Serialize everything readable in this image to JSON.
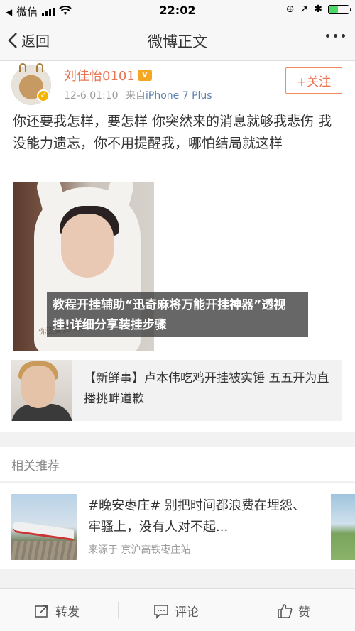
{
  "status_bar": {
    "carrier": "微信",
    "network": "4G",
    "time": "22:02"
  },
  "nav": {
    "back_label": "返回",
    "title": "微博正文"
  },
  "post": {
    "username": "刘佳怡0101",
    "time": "12-6 01:10",
    "source_prefix": "来自",
    "device": "iPhone 7 Plus",
    "follow_label": "+关注",
    "text": "你还要我怎样，要怎样 你突然来的消息就够我悲伤 我没能力遗忘，你不用提醒我，哪怕结局就这样",
    "image_watermark": "你还要我怎样"
  },
  "overlay": {
    "text": "教程开挂辅助“迅奇麻将万能开挂神器”透视挂!详细分享装挂步骤"
  },
  "news_card": {
    "text": "【新鲜事】卢本伟吃鸡开挂被实锤 五五开为直播挑衅道歉"
  },
  "related": {
    "header": "相关推荐",
    "title": "#晚安枣庄# 别把时间都浪费在埋怨、牢骚上，没有人对不起...",
    "source": "来源于 京沪高铁枣庄站"
  },
  "bottom_bar": {
    "repost": "转发",
    "comment": "评论",
    "like": "赞"
  },
  "colors": {
    "accent": "#eb7350",
    "link": "#5d7fae",
    "battery": "#4cd964"
  }
}
